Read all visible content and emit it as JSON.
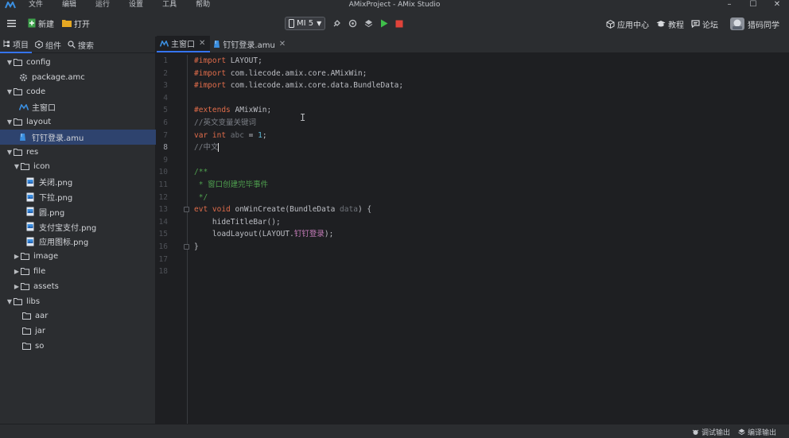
{
  "menu": {
    "items": [
      "文件",
      "编辑",
      "运行",
      "设置",
      "工具",
      "帮助"
    ]
  },
  "window": {
    "title": "AMixProject - AMix Studio",
    "minimize": "–",
    "maximize": "☐",
    "close": "✕"
  },
  "toolbar": {
    "new_label": "新建",
    "open_label": "打开",
    "device_label": "MI 5",
    "links": [
      "应用中心",
      "教程",
      "论坛"
    ],
    "user_label": "猎码同学"
  },
  "sidebar": {
    "tabs": [
      "项目",
      "组件",
      "搜索"
    ],
    "tree": [
      {
        "label": "config",
        "type": "folder",
        "depth": 0,
        "open": true
      },
      {
        "label": "package.amc",
        "type": "gear",
        "depth": 1
      },
      {
        "label": "code",
        "type": "folder",
        "depth": 0,
        "open": true
      },
      {
        "label": "主窗口",
        "type": "amix",
        "depth": 1
      },
      {
        "label": "layout",
        "type": "folder",
        "depth": 0,
        "open": true
      },
      {
        "label": "钉钉登录.amu",
        "type": "amu",
        "depth": 1,
        "selected": true
      },
      {
        "label": "res",
        "type": "folder",
        "depth": 0,
        "open": true
      },
      {
        "label": "icon",
        "type": "folder",
        "depth": 1,
        "open": true
      },
      {
        "label": "关闭.png",
        "type": "image",
        "depth": 2
      },
      {
        "label": "下拉.png",
        "type": "image",
        "depth": 2
      },
      {
        "label": "圆.png",
        "type": "image",
        "depth": 2
      },
      {
        "label": "支付宝支付.png",
        "type": "image",
        "depth": 2
      },
      {
        "label": "应用图标.png",
        "type": "image",
        "depth": 2
      },
      {
        "label": "image",
        "type": "folder",
        "depth": 1,
        "open": false
      },
      {
        "label": "file",
        "type": "folder",
        "depth": 1,
        "open": false
      },
      {
        "label": "assets",
        "type": "folder",
        "depth": 1,
        "open": false
      },
      {
        "label": "libs",
        "type": "folder",
        "depth": 0,
        "open": true
      },
      {
        "label": "aar",
        "type": "folder-leaf",
        "depth": 1
      },
      {
        "label": "jar",
        "type": "folder-leaf",
        "depth": 1
      },
      {
        "label": "so",
        "type": "folder-leaf",
        "depth": 1
      }
    ]
  },
  "editor": {
    "tabs": [
      {
        "label": "主窗口",
        "active": true,
        "close": "✕"
      },
      {
        "label": "钉钉登录.amu",
        "active": false,
        "close": "✕"
      }
    ],
    "current_line": 8,
    "line_numbers": [
      "1",
      "2",
      "3",
      "4",
      "5",
      "6",
      "7",
      "8",
      "9",
      "10",
      "11",
      "12",
      "13",
      "14",
      "15",
      "16",
      "17",
      "18"
    ],
    "lines": [
      [
        [
          "kw-import",
          "#import"
        ],
        [
          "",
          "LAYOUT;"
        ]
      ],
      [
        [
          "kw-import",
          "#import"
        ],
        [
          "",
          "com.liecode.amix.core.AMixWin;"
        ]
      ],
      [
        [
          "kw-import",
          "#import"
        ],
        [
          "",
          "com.liecode.amix.core.data.BundleData;"
        ]
      ],
      [],
      [
        [
          "kw",
          "#extends"
        ],
        [
          "",
          " AMixWin;"
        ]
      ],
      [
        [
          "cm",
          "//英文变量关键词"
        ]
      ],
      [
        [
          "kw",
          "var int"
        ],
        [
          "var",
          " abc"
        ],
        [
          "",
          " = "
        ],
        [
          "num",
          "1"
        ],
        [
          "",
          ";"
        ]
      ],
      [
        [
          "cm",
          "//中文"
        ],
        [
          "caret",
          ""
        ]
      ],
      [],
      [
        [
          "jd",
          "/**"
        ]
      ],
      [
        [
          "jd",
          " * 窗口创建完毕事件"
        ]
      ],
      [
        [
          "jd",
          " */"
        ]
      ],
      [
        [
          "kw",
          "evt void"
        ],
        [
          "",
          " onWinCreate(BundleData "
        ],
        [
          "var",
          "data"
        ],
        [
          "",
          ") {"
        ]
      ],
      [
        [
          "",
          "    hideTitleBar();"
        ]
      ],
      [
        [
          "",
          "    loadLayout(LAYOUT."
        ],
        [
          "purple",
          "钉钉登录"
        ],
        [
          "",
          ");"
        ]
      ],
      [
        [
          "",
          "}"
        ]
      ],
      [],
      []
    ]
  },
  "status": {
    "debug_output": "调试输出",
    "compile_output": "编译输出"
  },
  "colors": {
    "accent": "#3574f0",
    "keyword": "#e06c4a",
    "comment": "#7a7e85",
    "doc": "#4fa04f",
    "run": "#3fbf4a",
    "stop": "#e0433a",
    "selection": "#2e436e"
  }
}
